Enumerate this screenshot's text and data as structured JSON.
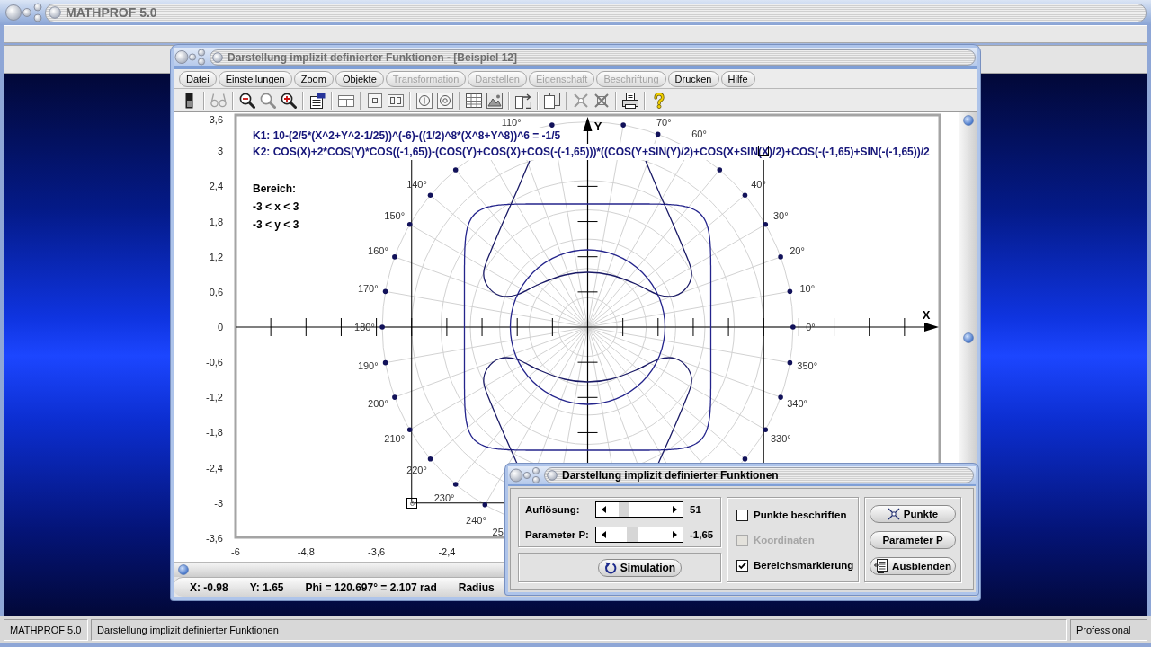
{
  "app_window": {
    "title": "MATHPROF 5.0"
  },
  "plot_window": {
    "title": "Darstellung implizit definierter Funktionen - [Beispiel 12]",
    "menu": [
      {
        "label": "Datei",
        "disabled": false
      },
      {
        "label": "Einstellungen",
        "disabled": false
      },
      {
        "label": "Zoom",
        "disabled": false
      },
      {
        "label": "Objekte",
        "disabled": false
      },
      {
        "label": "Transformation",
        "disabled": true
      },
      {
        "label": "Darstellen",
        "disabled": true
      },
      {
        "label": "Eigenschaft",
        "disabled": true
      },
      {
        "label": "Beschriftung",
        "disabled": true
      },
      {
        "label": "Drucken",
        "disabled": false
      },
      {
        "label": "Hilfe",
        "disabled": false
      }
    ],
    "plot": {
      "formulas": [
        "K1: 10-(2/5*(X^2+Y^2-1/25))^(-6)-((1/2)^8*(X^8+Y^8))^6 = -1/5",
        "K2: COS(X)+2*COS(Y)*COS((-1,65))-(COS(Y)+COS(X)+COS(-(-1,65)))*((COS(Y+SIN(Y)/2)+COS(X+SIN(X)/2)+COS(-(-1,65)+SIN(-(-1,65))/2"
      ],
      "range_label": "Bereich:",
      "range_lines": [
        "-3 < x < 3",
        "-3 < y < 3"
      ],
      "y_axis_label": "Y",
      "x_axis_label": "X",
      "y_ticks": [
        "3,6",
        "3",
        "2,4",
        "1,8",
        "1,2",
        "0,6",
        "0",
        "-0,6",
        "-1,2",
        "-1,8",
        "-2,4",
        "-3",
        "-3,6"
      ],
      "x_ticks": [
        "-6",
        "-4,8",
        "-3,6",
        "-2,4"
      ],
      "angle_labels": [
        "110°",
        "70°",
        "60°",
        "140°",
        "40°",
        "150°",
        "30°",
        "160°",
        "20°",
        "170°",
        "10°",
        "180°",
        "0°",
        "190°",
        "350°",
        "200°",
        "340°",
        "210°",
        "330°",
        "220°",
        "230°",
        "240°",
        "25"
      ]
    },
    "status": [
      "X: -0.98",
      "Y: 1.65",
      "Phi = 120.697° = 2.107 rad",
      "Radius"
    ]
  },
  "dialog": {
    "title": "Darstellung implizit definierter Funktionen",
    "sliders": [
      {
        "label": "Auflösung:",
        "level": 0.17,
        "value": "51"
      },
      {
        "label": "Parameter P:",
        "level": 0.35,
        "value": "-1,65"
      }
    ],
    "simulation_button": "Simulation",
    "options": [
      {
        "label": "Punkte beschriften",
        "checked": false,
        "disabled": false
      },
      {
        "label": "Koordinaten",
        "checked": false,
        "disabled": true
      },
      {
        "label": "Bereichsmarkierung",
        "checked": true,
        "disabled": false
      }
    ],
    "buttons": [
      "Punkte",
      "Parameter P",
      "Ausblenden"
    ]
  },
  "status_bar": [
    "MATHPROF 5.0",
    "Darstellung implizit definierter Funktionen",
    "Professional"
  ]
}
